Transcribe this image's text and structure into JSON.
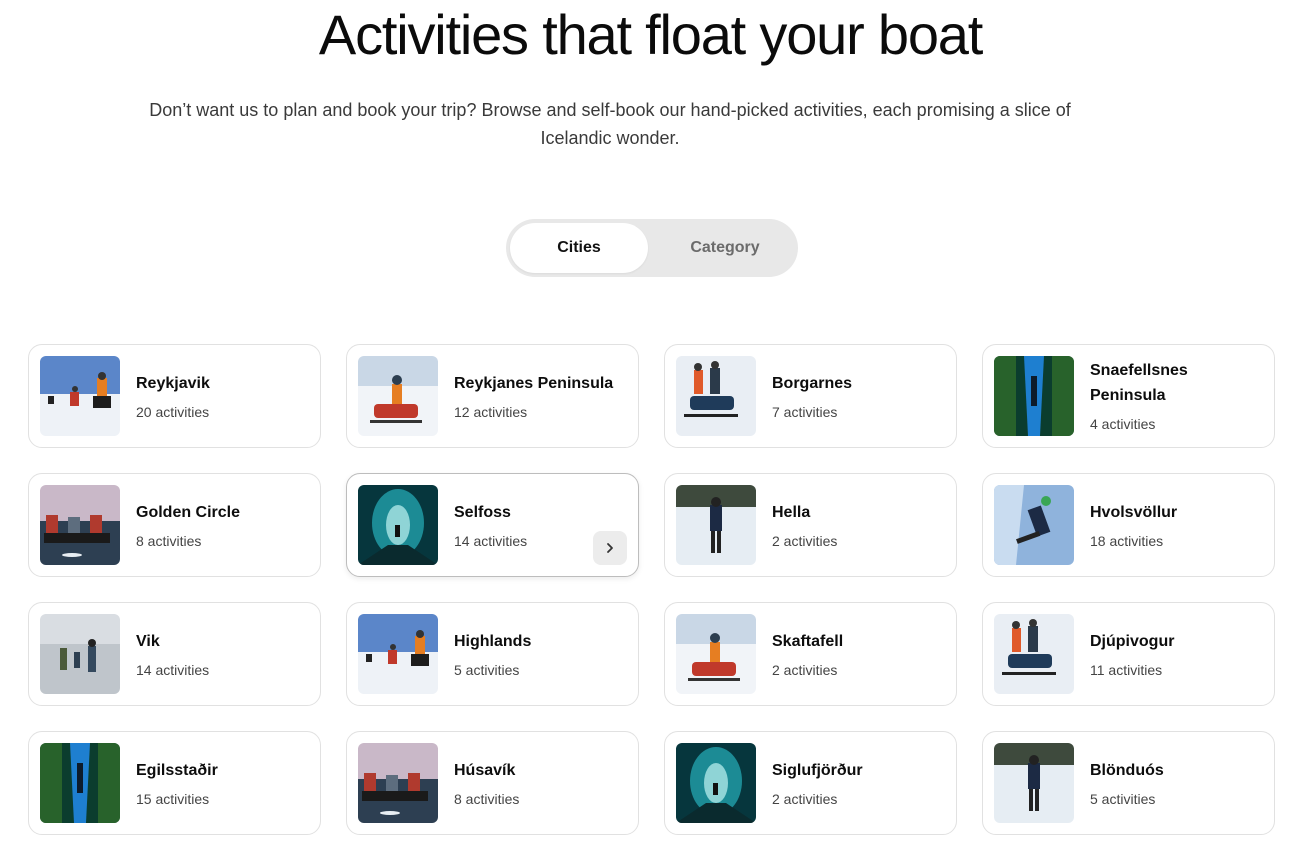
{
  "header": {
    "title": "Activities that float your boat",
    "subtitle": "Don’t want us to plan and book your trip? Browse and self-book our hand-picked activities, each promising a slice of Icelandic wonder."
  },
  "toggle": {
    "options": [
      {
        "label": "Cities",
        "active": true
      },
      {
        "label": "Category",
        "active": false
      }
    ]
  },
  "cards": [
    {
      "name": "Reykjavik",
      "count": "20 activities",
      "image": "snowmobile-group-blue-sky"
    },
    {
      "name": "Reykjanes Peninsula",
      "count": "12 activities",
      "image": "red-snowmobile-rider"
    },
    {
      "name": "Borgarnes",
      "count": "7 activities",
      "image": "snowmobile-couple-snow"
    },
    {
      "name": "Snaefellsnes Peninsula",
      "count": "4 activities",
      "image": "snorkel-fissure-blue"
    },
    {
      "name": "Golden Circle",
      "count": "8 activities",
      "image": "atv-riders-dusk"
    },
    {
      "name": "Selfoss",
      "count": "14 activities",
      "image": "ice-cave-teal",
      "hovered": true
    },
    {
      "name": "Hella",
      "count": "2 activities",
      "image": "glacier-hiker"
    },
    {
      "name": "Hvolsvöllur",
      "count": "18 activities",
      "image": "ice-climber"
    },
    {
      "name": "Vik",
      "count": "14 activities",
      "image": "glacier-walkers"
    },
    {
      "name": "Highlands",
      "count": "5 activities",
      "image": "snowmobile-group-blue-sky"
    },
    {
      "name": "Skaftafell",
      "count": "2 activities",
      "image": "red-snowmobile-rider"
    },
    {
      "name": "Djúpivogur",
      "count": "11 activities",
      "image": "snowmobile-couple-snow"
    },
    {
      "name": "Egilsstaðir",
      "count": "15 activities",
      "image": "snorkel-fissure-blue"
    },
    {
      "name": "Húsavík",
      "count": "8 activities",
      "image": "atv-riders-dusk"
    },
    {
      "name": "Siglufjörður",
      "count": "2 activities",
      "image": "ice-cave-teal"
    },
    {
      "name": "Blönduós",
      "count": "5 activities",
      "image": "glacier-hiker"
    }
  ],
  "colors": {
    "toggle_bg": "#e8e8e8",
    "card_border": "#e1e1e1",
    "arrow_btn_bg": "#ececec"
  }
}
